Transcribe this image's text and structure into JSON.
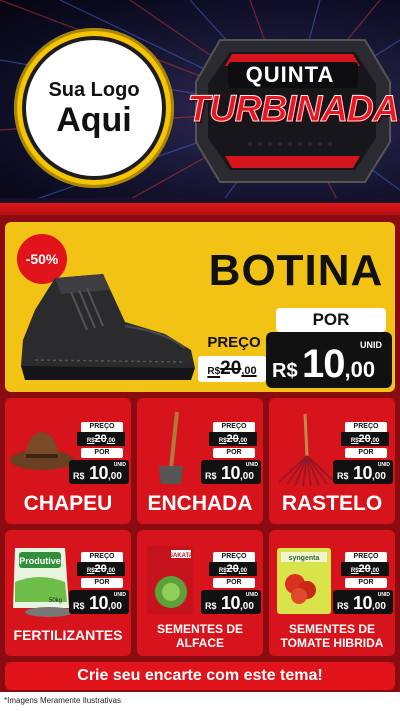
{
  "header": {
    "logo_line1": "Sua Logo",
    "logo_line2": "Aqui",
    "badge_line1": "QUINTA",
    "badge_line2": "TURBINADA"
  },
  "featured": {
    "discount": "-50%",
    "name": "BOTINA",
    "old_label": "PREÇO",
    "old_currency": "R$",
    "old_int": "20",
    "old_cents": ",00",
    "new_label": "POR",
    "unit": "UNID",
    "new_currency": "R$",
    "new_int": "10",
    "new_cents": ",00"
  },
  "cards": [
    {
      "name": "CHAPEU",
      "old_label": "PREÇO",
      "old_currency": "R$",
      "old_int": "20",
      "old_cents": ",00",
      "new_label": "POR",
      "unit": "UNID",
      "new_currency": "R$",
      "new_int": "10",
      "new_cents": ",00"
    },
    {
      "name": "ENCHADA",
      "old_label": "PREÇO",
      "old_currency": "R$",
      "old_int": "20",
      "old_cents": ",00",
      "new_label": "POR",
      "unit": "UNID",
      "new_currency": "R$",
      "new_int": "10",
      "new_cents": ",00"
    },
    {
      "name": "RASTELO",
      "old_label": "PREÇO",
      "old_currency": "R$",
      "old_int": "20",
      "old_cents": ",00",
      "new_label": "POR",
      "unit": "UNID",
      "new_currency": "R$",
      "new_int": "10",
      "new_cents": ",00"
    },
    {
      "name": "FERTILIZANTES",
      "img_text": "Produtive",
      "img_sub": "50kg",
      "old_label": "PREÇO",
      "old_currency": "R$",
      "old_int": "20",
      "old_cents": ",00",
      "new_label": "POR",
      "unit": "UNID",
      "new_currency": "R$",
      "new_int": "10",
      "new_cents": ",00"
    },
    {
      "name_line1": "SEMENTES DE",
      "name_line2": "ALFACE",
      "img_text": "SAKATA",
      "old_label": "PREÇO",
      "old_currency": "R$",
      "old_int": "20",
      "old_cents": ",00",
      "new_label": "POR",
      "unit": "UNID",
      "new_currency": "R$",
      "new_int": "10",
      "new_cents": ",00"
    },
    {
      "name_line1": "SEMENTES DE",
      "name_line2": "TOMATE HIBRIDA",
      "img_text": "syngenta",
      "old_label": "PREÇO",
      "old_currency": "R$",
      "old_int": "20",
      "old_cents": ",00",
      "new_label": "POR",
      "unit": "UNID",
      "new_currency": "R$",
      "new_int": "10",
      "new_cents": ",00"
    }
  ],
  "cta": "Crie seu encarte com este tema!",
  "disclaimer": "*Imagens Meramente Ilustrativas",
  "colors": {
    "red": "#d7131b",
    "yellow": "#f2c315",
    "dark": "#111111",
    "background": "#8a0c10"
  }
}
